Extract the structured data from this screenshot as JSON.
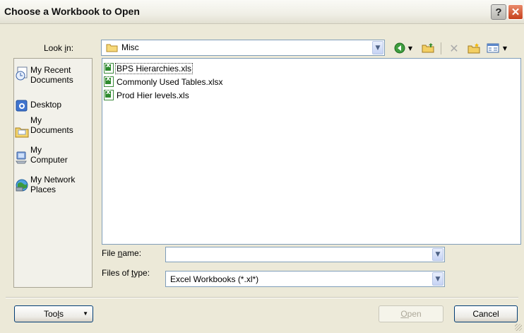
{
  "title": "Choose a Workbook to Open",
  "titlebar": {
    "help_label": "?",
    "close_label": "✕"
  },
  "look_in": {
    "label_pre": "Look ",
    "label_u": "i",
    "label_post": "n:",
    "value": "Misc",
    "icon": "folder-icon"
  },
  "toolbar": [
    {
      "name": "back-icon",
      "glyph": "◀"
    },
    {
      "name": "up-folder-icon",
      "glyph": "▲"
    },
    {
      "name": "delete-icon",
      "glyph": "✕"
    },
    {
      "name": "new-folder-icon",
      "glyph": "✦"
    },
    {
      "name": "views-icon",
      "glyph": "▦"
    }
  ],
  "places": [
    {
      "label": "My Recent\nDocuments",
      "icon": "recent-documents-icon"
    },
    {
      "label": "Desktop",
      "icon": "desktop-icon"
    },
    {
      "label": "My\nDocuments",
      "icon": "my-documents-icon"
    },
    {
      "label": "My\nComputer",
      "icon": "my-computer-icon"
    },
    {
      "label": "My Network\nPlaces",
      "icon": "network-places-icon"
    }
  ],
  "files": [
    {
      "name": "BPS Hierarchies.xls",
      "focused": true
    },
    {
      "name": "Commonly Used Tables.xlsx",
      "focused": false
    },
    {
      "name": "Prod Hier levels.xls",
      "focused": false
    }
  ],
  "file_name": {
    "label_pre": "File ",
    "label_u": "n",
    "label_post": "ame:",
    "value": ""
  },
  "file_type": {
    "label_pre": "Files of ",
    "label_u": "t",
    "label_post": "ype:",
    "value": "Excel Workbooks (*.xl*)"
  },
  "buttons": {
    "tools_pre": "Too",
    "tools_u": "l",
    "tools_post": "s",
    "open_u": "O",
    "open_post": "pen",
    "cancel": "Cancel"
  },
  "colors": {
    "accent_border": "#7f9db9",
    "dialog_bg": "#ece9d8",
    "excel_green": "#2e8b2e"
  }
}
